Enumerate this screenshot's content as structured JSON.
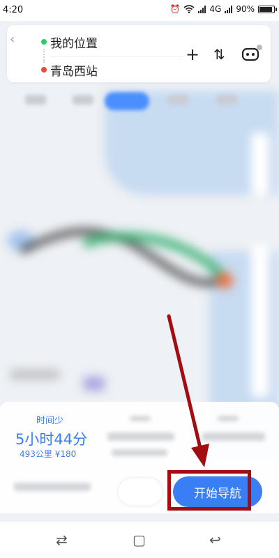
{
  "status_bar": {
    "time": "4:20",
    "network": "4G",
    "battery": "90%",
    "battery_level": 0.9,
    "icons": [
      "alarm-icon",
      "wifi-icon",
      "signal-icon",
      "battery-icon"
    ]
  },
  "route": {
    "origin": "我的位置",
    "destination": "青岛西站",
    "origin_color": "#2ecc71",
    "destination_color": "#e74c3c"
  },
  "header_actions": {
    "add": "+",
    "swap": "⇅"
  },
  "plan": {
    "label": "时间少",
    "duration": "5小时44分",
    "meta": "493公里 ¥180"
  },
  "actions": {
    "start_navigation": "开始导航"
  },
  "colors": {
    "accent": "#3a7ef5",
    "annotation": "#a30d12"
  }
}
